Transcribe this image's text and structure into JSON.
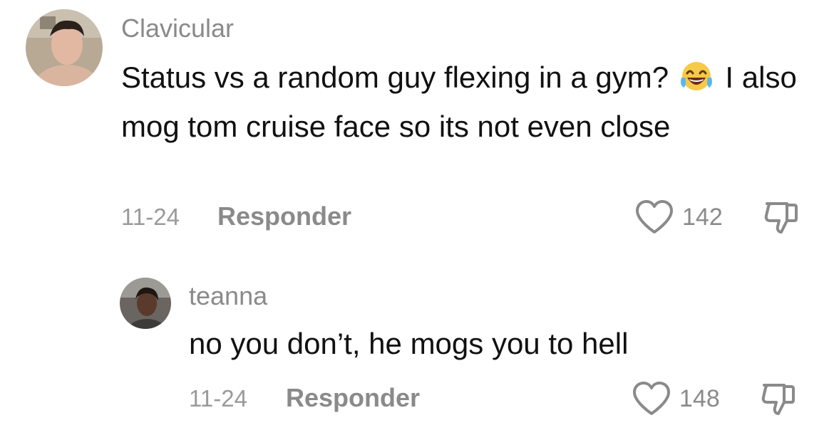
{
  "comments": [
    {
      "username": "Clavicular",
      "text_line1_before_emoji": "Status vs a random guy flexing in a gym?",
      "emoji": "face-with-tears-of-joy",
      "text_line1_after_emoji": "I",
      "text_rest": "also mog tom cruise face so its not even close",
      "date": "11-24",
      "reply_label": "Responder",
      "likes": "142"
    },
    {
      "username": "teanna",
      "text": "no you don’t, he mogs you to hell",
      "date": "11-24",
      "reply_label": "Responder",
      "likes": "148"
    }
  ],
  "colors": {
    "text": "#111111",
    "muted": "#8a8a8a"
  }
}
